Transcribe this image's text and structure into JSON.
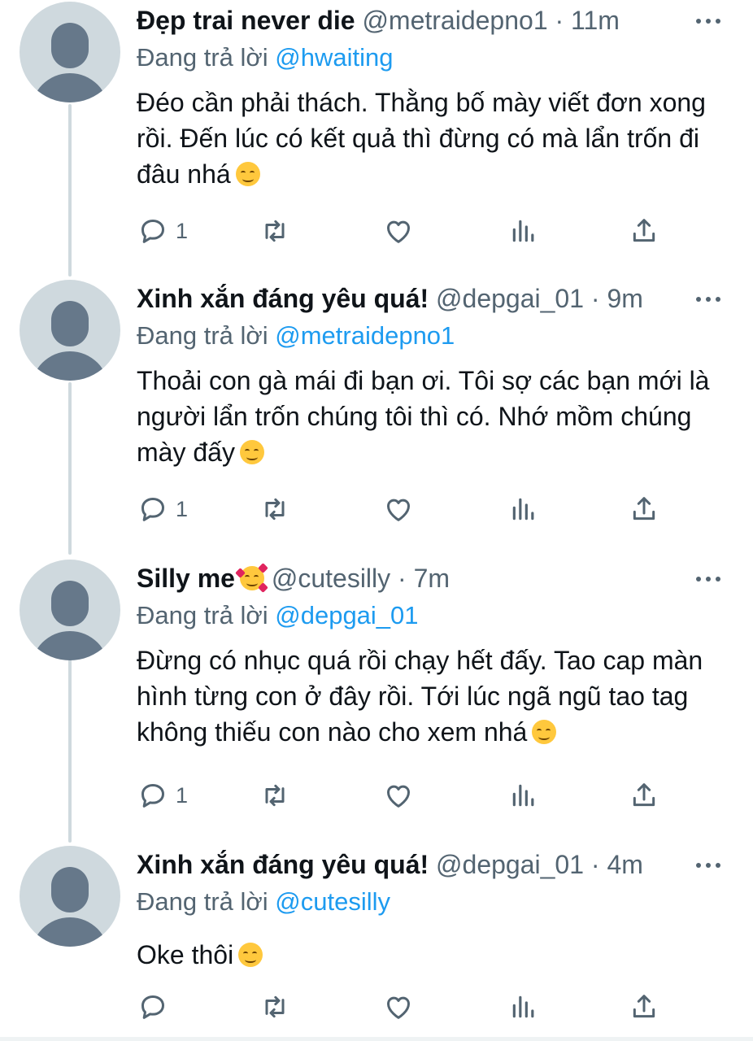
{
  "tweets": [
    {
      "name": "Đẹp trai never die",
      "name_emoji": "",
      "handle": "@metraidepno1",
      "time": "11m",
      "reply_prefix": "Đang trả lời",
      "reply_to": "@hwaiting",
      "text": "Đéo cần phải thách. Thằng bố mày viết đơn xong rồi. Đến lúc có kết quả thì đừng có mà lẩn trốn đi đâu nhá",
      "text_emoji": "smirking-face",
      "reply_count": "1"
    },
    {
      "name": "Xinh xắn đáng yêu quá!",
      "name_emoji": "",
      "handle": "@depgai_01",
      "time": "9m",
      "reply_prefix": "Đang trả lời",
      "reply_to": "@metraidepno1",
      "text": "Thoải con gà mái đi bạn ơi. Tôi sợ các bạn mới là người lẩn trốn chúng tôi thì có. Nhớ mồm chúng mày đấy",
      "text_emoji": "relieved-face",
      "reply_count": "1"
    },
    {
      "name": "Silly me",
      "name_emoji": "smiling-face-with-hearts",
      "handle": "@cutesilly",
      "time": "7m",
      "reply_prefix": "Đang trả lời",
      "reply_to": "@depgai_01",
      "text": "Đừng có nhục quá rồi chạy hết đấy. Tao cap màn hình từng con ở đây rồi. Tới lúc ngã ngũ tao tag không thiếu con nào cho xem nhá",
      "text_emoji": "smirking-face",
      "reply_count": "1"
    },
    {
      "name": "Xinh xắn đáng yêu quá!",
      "name_emoji": "",
      "handle": "@depgai_01",
      "time": "4m",
      "reply_prefix": "Đang trả lời",
      "reply_to": "@cutesilly",
      "text": "Oke thôi",
      "text_emoji": "relieved-face",
      "reply_count": ""
    }
  ],
  "separator": "·",
  "icons": [
    "reply-icon",
    "retweet-icon",
    "like-icon",
    "analytics-icon",
    "share-icon",
    "more-options-icon"
  ],
  "colors": {
    "text": "#0f1419",
    "secondary": "#536471",
    "mention": "#1d9bf0",
    "avatar_bg": "#cfd9de",
    "avatar_fg": "#66788a",
    "thread_line": "#cfd9de"
  }
}
